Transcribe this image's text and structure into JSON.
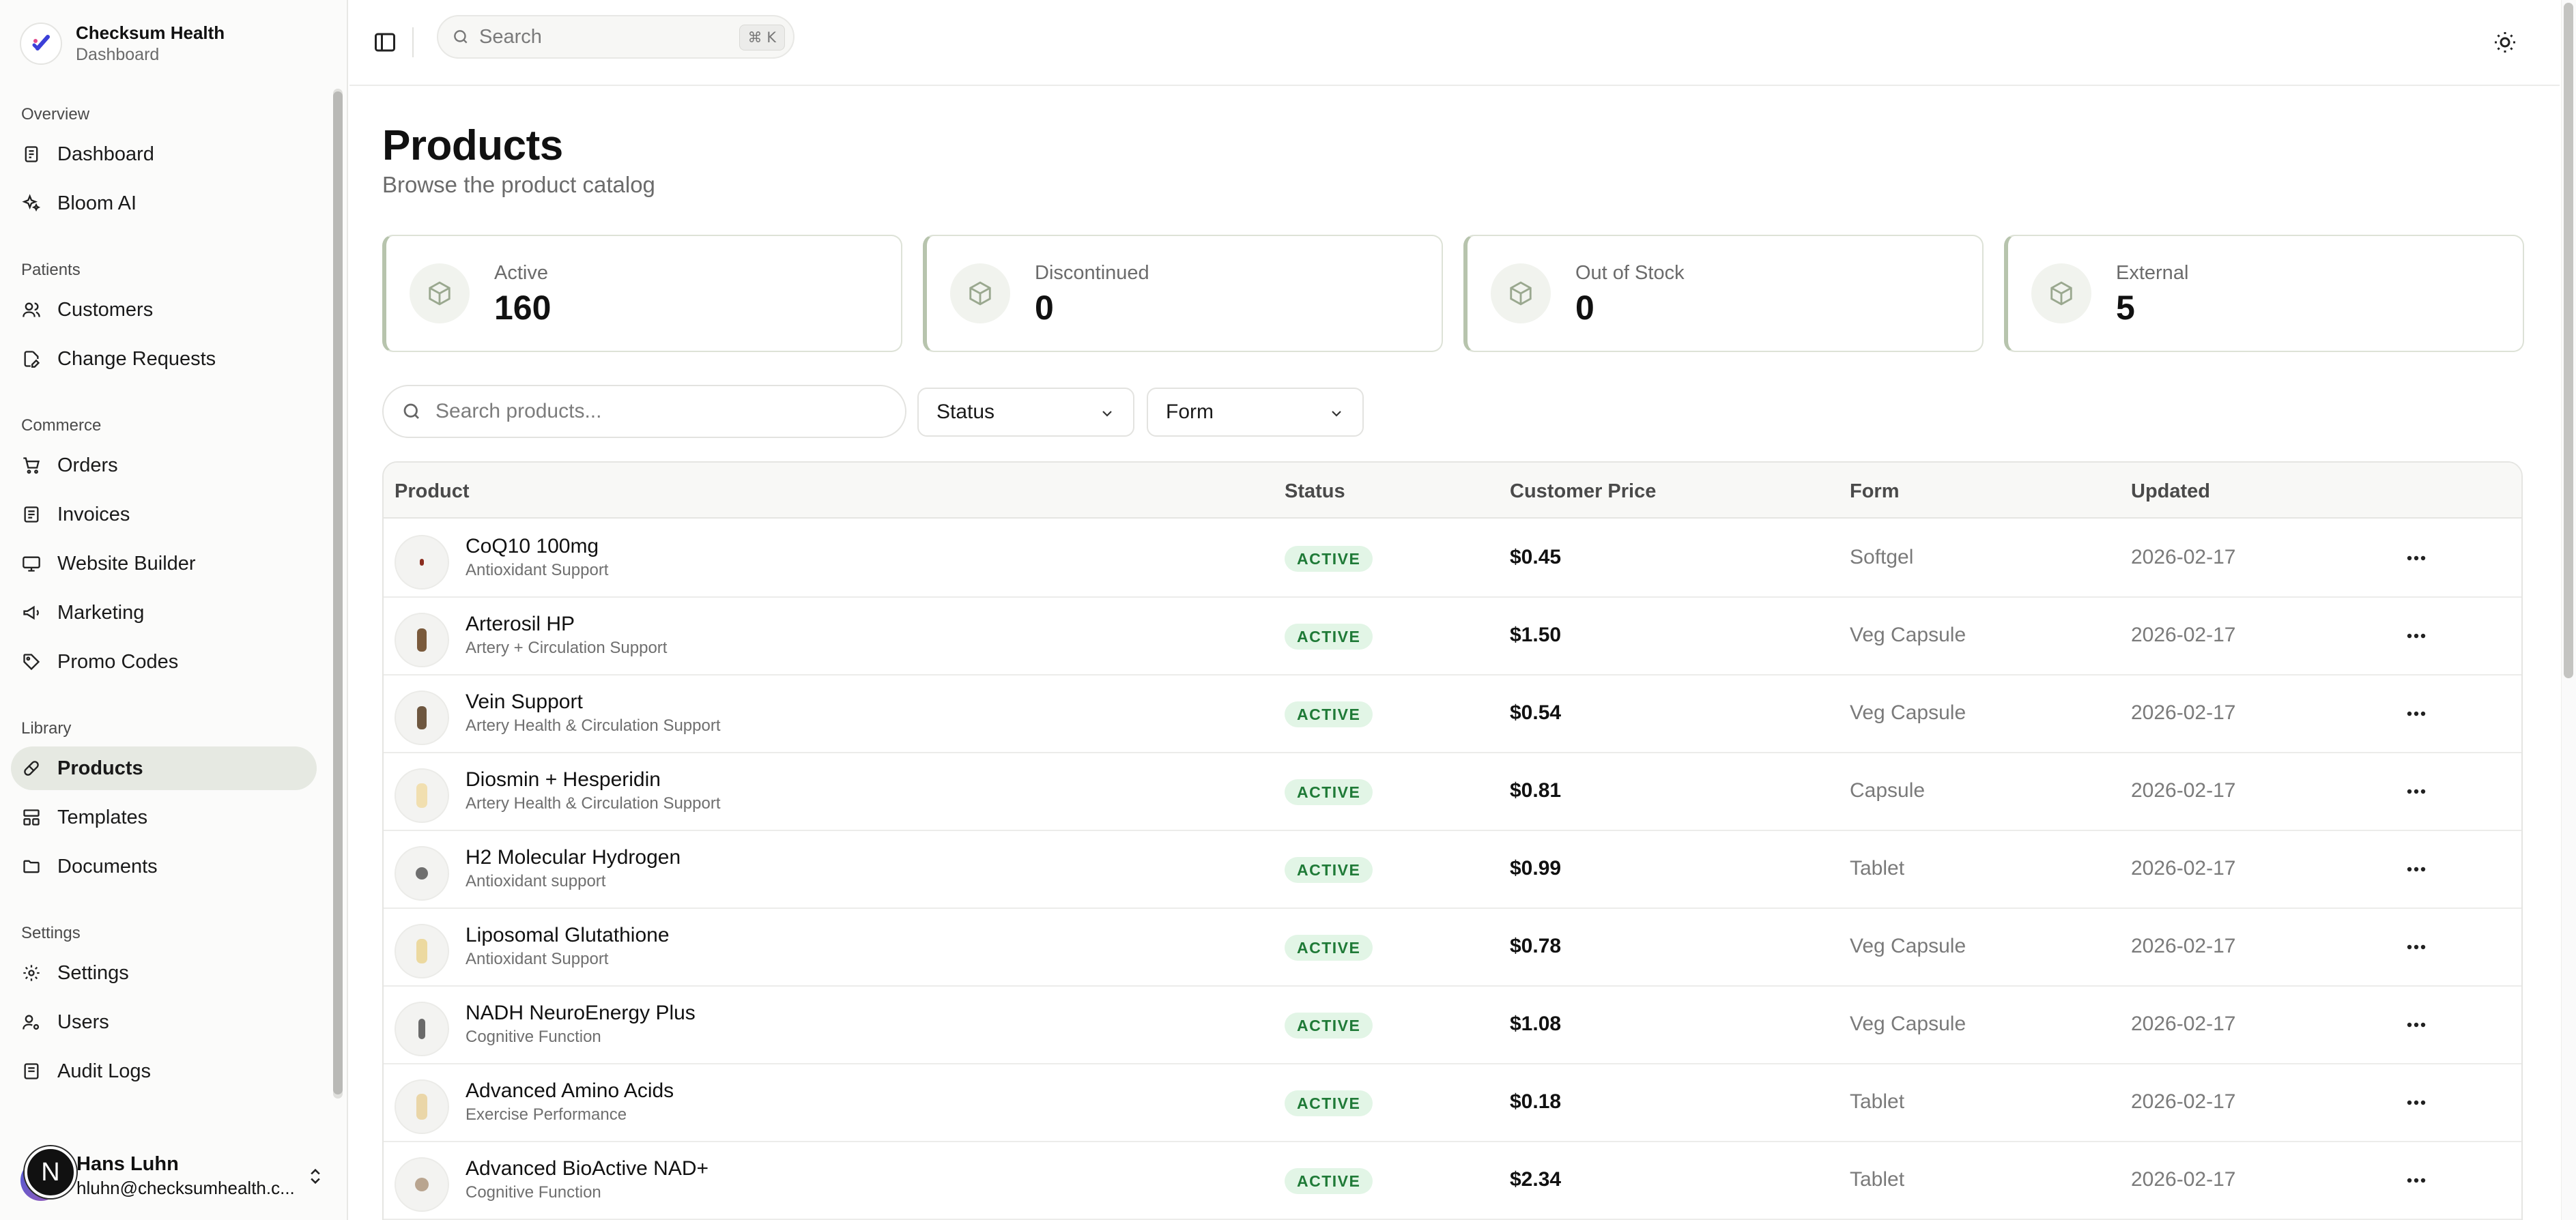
{
  "brand": {
    "name": "Checksum Health",
    "subtitle": "Dashboard"
  },
  "topbar": {
    "search_placeholder": "Search",
    "search_shortcut": "⌘ K"
  },
  "sidebar": {
    "sections": [
      {
        "heading": "Overview",
        "items": [
          {
            "label": "Dashboard",
            "icon": "dashboard-icon"
          },
          {
            "label": "Bloom AI",
            "icon": "sparkles-icon"
          }
        ]
      },
      {
        "heading": "Patients",
        "items": [
          {
            "label": "Customers",
            "icon": "users-icon"
          },
          {
            "label": "Change Requests",
            "icon": "file-edit-icon"
          }
        ]
      },
      {
        "heading": "Commerce",
        "items": [
          {
            "label": "Orders",
            "icon": "cart-icon"
          },
          {
            "label": "Invoices",
            "icon": "receipt-icon"
          },
          {
            "label": "Website Builder",
            "icon": "monitor-icon"
          },
          {
            "label": "Marketing",
            "icon": "megaphone-icon"
          },
          {
            "label": "Promo Codes",
            "icon": "tag-icon"
          }
        ]
      },
      {
        "heading": "Library",
        "items": [
          {
            "label": "Products",
            "icon": "pill-icon",
            "active": true
          },
          {
            "label": "Templates",
            "icon": "layout-icon"
          },
          {
            "label": "Documents",
            "icon": "folder-icon"
          }
        ]
      },
      {
        "heading": "Settings",
        "items": [
          {
            "label": "Settings",
            "icon": "gear-icon"
          },
          {
            "label": "Users",
            "icon": "user-cog-icon"
          },
          {
            "label": "Audit Logs",
            "icon": "log-icon"
          }
        ]
      }
    ],
    "user": {
      "name": "Hans Luhn",
      "email": "hluhn@checksumhealth.c...",
      "avatar_letter": "N"
    }
  },
  "page": {
    "title": "Products",
    "subtitle": "Browse the product catalog"
  },
  "stats": [
    {
      "label": "Active",
      "value": "160"
    },
    {
      "label": "Discontinued",
      "value": "0"
    },
    {
      "label": "Out of Stock",
      "value": "0"
    },
    {
      "label": "External",
      "value": "5"
    }
  ],
  "filters": {
    "search_placeholder": "Search products...",
    "status_label": "Status",
    "form_label": "Form"
  },
  "table": {
    "columns": [
      "Product",
      "Status",
      "Customer Price",
      "Form",
      "Updated"
    ],
    "rows": [
      {
        "name": "CoQ10 100mg",
        "category": "Antioxidant Support",
        "status": "ACTIVE",
        "price": "$0.45",
        "form": "Softgel",
        "updated": "2026-02-17",
        "pill_color": "#8b2d1f"
      },
      {
        "name": "Arterosil HP",
        "category": "Artery + Circulation Support",
        "status": "ACTIVE",
        "price": "$1.50",
        "form": "Veg Capsule",
        "updated": "2026-02-17",
        "pill_color": "#7a5a3c"
      },
      {
        "name": "Vein Support",
        "category": "Artery Health & Circulation Support",
        "status": "ACTIVE",
        "price": "$0.54",
        "form": "Veg Capsule",
        "updated": "2026-02-17",
        "pill_color": "#6e5740"
      },
      {
        "name": "Diosmin + Hesperidin",
        "category": "Artery Health & Circulation Support",
        "status": "ACTIVE",
        "price": "$0.81",
        "form": "Capsule",
        "updated": "2026-02-17",
        "pill_color": "#f1dfb0"
      },
      {
        "name": "H2 Molecular Hydrogen",
        "category": "Antioxidant support",
        "status": "ACTIVE",
        "price": "$0.99",
        "form": "Tablet",
        "updated": "2026-02-17",
        "pill_color": "#6f6f6f"
      },
      {
        "name": "Liposomal Glutathione",
        "category": "Antioxidant Support",
        "status": "ACTIVE",
        "price": "$0.78",
        "form": "Veg Capsule",
        "updated": "2026-02-17",
        "pill_color": "#ecd9a0"
      },
      {
        "name": "NADH NeuroEnergy Plus",
        "category": "Cognitive Function",
        "status": "ACTIVE",
        "price": "$1.08",
        "form": "Veg Capsule",
        "updated": "2026-02-17",
        "pill_color": "#6a6a6a"
      },
      {
        "name": "Advanced Amino Acids",
        "category": "Exercise Performance",
        "status": "ACTIVE",
        "price": "$0.18",
        "form": "Tablet",
        "updated": "2026-02-17",
        "pill_color": "#ead6a8"
      },
      {
        "name": "Advanced BioActive NAD+",
        "category": "Cognitive Function",
        "status": "ACTIVE",
        "price": "$2.34",
        "form": "Tablet",
        "updated": "2026-02-17",
        "pill_color": "#b9a590"
      }
    ]
  },
  "colors": {
    "accent_green": "#1f7a37",
    "badge_bg": "#e2f5e6",
    "active_nav_bg": "#e6e9e2",
    "stat_border": "#b7c4ad"
  }
}
